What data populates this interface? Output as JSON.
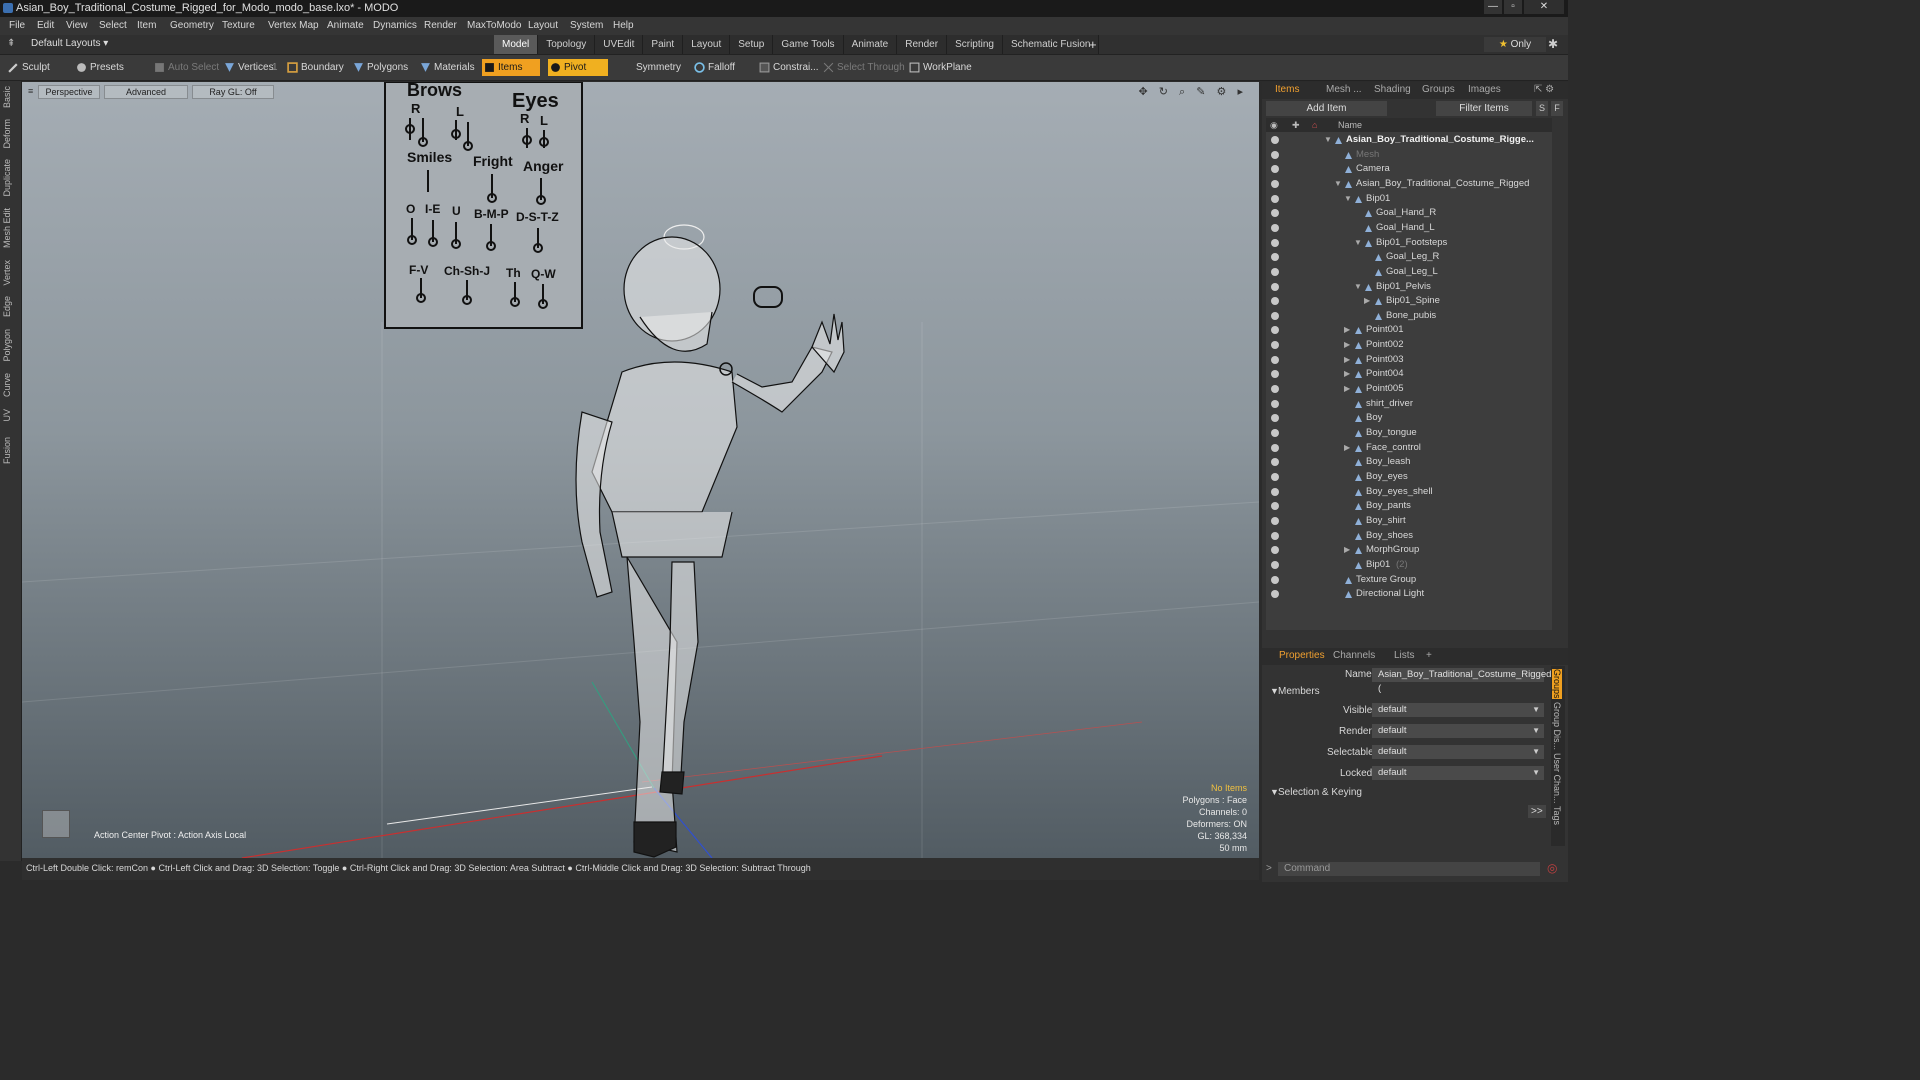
{
  "window": {
    "title": "Asian_Boy_Traditional_Costume_Rigged_for_Modo_modo_base.lxo* - MODO",
    "buttons": [
      "—",
      "▫",
      "✕"
    ]
  },
  "menu": [
    "File",
    "Edit",
    "View",
    "Select",
    "Item",
    "Geometry",
    "Texture",
    "Vertex Map",
    "Animate",
    "Dynamics",
    "Render",
    "MaxToModo",
    "Layout",
    "System",
    "Help"
  ],
  "layout_selector": "Default Layouts ▾",
  "layout_tabs": [
    "Model",
    "Topology",
    "UVEdit",
    "Paint",
    "Layout",
    "Setup",
    "Game Tools",
    "Animate",
    "Render",
    "Scripting",
    "Schematic Fusion"
  ],
  "active_layout_tab": "Model",
  "add_tab": "+",
  "only_button": {
    "star": "★",
    "label": "Only"
  },
  "toolbar": {
    "sculpt": "Sculpt",
    "presets": "Presets",
    "auto_select": "Auto Select",
    "vertices": "Vertices",
    "vertices_count": "1",
    "boundary": "Boundary",
    "polygons": "Polygons",
    "materials": "Materials",
    "items": "Items",
    "pivot": "Pivot",
    "symmetry": "Symmetry",
    "falloff": "Falloff",
    "constraints": "Constrai...",
    "select_through": "Select Through",
    "workplane": "WorkPlane"
  },
  "left_tabs": [
    "Basic",
    "Deform",
    "Duplicate",
    "Mesh Edit",
    "Vertex",
    "Edge",
    "Polygon",
    "Curve",
    "UV",
    "Fusion"
  ],
  "viewport": {
    "view": "Perspective",
    "mode": "Advanced",
    "raygl": "Ray GL: Off",
    "face_board": {
      "brows": "Brows",
      "eyes": "Eyes",
      "r1": "R",
      "l1": "L",
      "r2": "R",
      "l2": "L",
      "smiles": "Smiles",
      "fright": "Fright",
      "anger": "Anger",
      "o": "O",
      "ie": "I-E",
      "u": "U",
      "bmp": "B-M-P",
      "dstz": "D-S-T-Z",
      "fv": "F-V",
      "chshj": "Ch-Sh-J",
      "th": "Th",
      "qw": "Q-W"
    },
    "info": {
      "selection": "No Items",
      "polygons": "Polygons : Face",
      "channels": "Channels: 0",
      "deformers": "Deformers: ON",
      "gl": "GL: 368,334",
      "scale": "50 mm"
    },
    "action_center": "Action Center Pivot : Action Axis Local"
  },
  "status_hint": "Ctrl-Left Double Click: remCon ● Ctrl-Left Click and Drag: 3D Selection: Toggle ● Ctrl-Right Click and Drag: 3D Selection: Area Subtract ● Ctrl-Middle Click and Drag: 3D Selection: Subtract Through",
  "right_tabs": [
    "Items",
    "Mesh ...",
    "Shading",
    "Groups",
    "Images"
  ],
  "add_item": "Add Item",
  "filter_items": "Filter Items",
  "filter_buttons": [
    "S",
    "F"
  ],
  "tree_header": "Name",
  "tree": [
    {
      "label": "Asian_Boy_Traditional_Costume_Rigge...",
      "depth": 0,
      "bold": true,
      "exp": "▼"
    },
    {
      "label": "Mesh",
      "depth": 1,
      "dim": true,
      "exp": ""
    },
    {
      "label": "Camera",
      "depth": 1,
      "exp": ""
    },
    {
      "label": "Asian_Boy_Traditional_Costume_Rigged",
      "depth": 1,
      "exp": "▼"
    },
    {
      "label": "Bip01",
      "depth": 2,
      "exp": "▼"
    },
    {
      "label": "Goal_Hand_R",
      "depth": 3,
      "exp": ""
    },
    {
      "label": "Goal_Hand_L",
      "depth": 3,
      "exp": ""
    },
    {
      "label": "Bip01_Footsteps",
      "depth": 3,
      "exp": "▼"
    },
    {
      "label": "Goal_Leg_R",
      "depth": 4,
      "exp": ""
    },
    {
      "label": "Goal_Leg_L",
      "depth": 4,
      "exp": ""
    },
    {
      "label": "Bip01_Pelvis",
      "depth": 3,
      "exp": "▼"
    },
    {
      "label": "Bip01_Spine",
      "depth": 4,
      "exp": "▶"
    },
    {
      "label": "Bone_pubis",
      "depth": 4,
      "exp": ""
    },
    {
      "label": "Point001",
      "depth": 2,
      "exp": "▶"
    },
    {
      "label": "Point002",
      "depth": 2,
      "exp": "▶"
    },
    {
      "label": "Point003",
      "depth": 2,
      "exp": "▶"
    },
    {
      "label": "Point004",
      "depth": 2,
      "exp": "▶"
    },
    {
      "label": "Point005",
      "depth": 2,
      "exp": "▶"
    },
    {
      "label": "shirt_driver",
      "depth": 2,
      "exp": ""
    },
    {
      "label": "Boy",
      "depth": 2,
      "exp": ""
    },
    {
      "label": "Boy_tongue",
      "depth": 2,
      "exp": ""
    },
    {
      "label": "Face_control",
      "depth": 2,
      "exp": "▶"
    },
    {
      "label": "Boy_leash",
      "depth": 2,
      "exp": ""
    },
    {
      "label": "Boy_eyes",
      "depth": 2,
      "exp": ""
    },
    {
      "label": "Boy_eyes_shell",
      "depth": 2,
      "exp": ""
    },
    {
      "label": "Boy_pants",
      "depth": 2,
      "exp": ""
    },
    {
      "label": "Boy_shirt",
      "depth": 2,
      "exp": ""
    },
    {
      "label": "Boy_shoes",
      "depth": 2,
      "exp": ""
    },
    {
      "label": "MorphGroup",
      "depth": 2,
      "exp": "▶"
    },
    {
      "label": "Bip01",
      "depth": 2,
      "exp": "",
      "suffix": "(2)"
    },
    {
      "label": "Texture Group",
      "depth": 1,
      "exp": ""
    },
    {
      "label": "Directional Light",
      "depth": 1,
      "exp": ""
    }
  ],
  "props_tabs": [
    "Properties",
    "Channels",
    "Lists",
    "+"
  ],
  "props": {
    "name_label": "Name",
    "name_value": "Asian_Boy_Traditional_Costume_Rigged (",
    "members": "Members",
    "visible_label": "Visible",
    "visible_value": "default",
    "render_label": "Render",
    "render_value": "default",
    "selectable_label": "Selectable",
    "selectable_value": "default",
    "locked_label": "Locked",
    "locked_value": "default",
    "selection_keying": "Selection & Keying",
    "more": ">>"
  },
  "side_tabs": [
    "Groups",
    "Group Dis...",
    "User Chan...",
    "Tags"
  ],
  "command_placeholder": "Command",
  "colors": {
    "accent": "#f0a020",
    "viewport_top": "#a5adb4",
    "viewport_bottom": "#525c63"
  }
}
